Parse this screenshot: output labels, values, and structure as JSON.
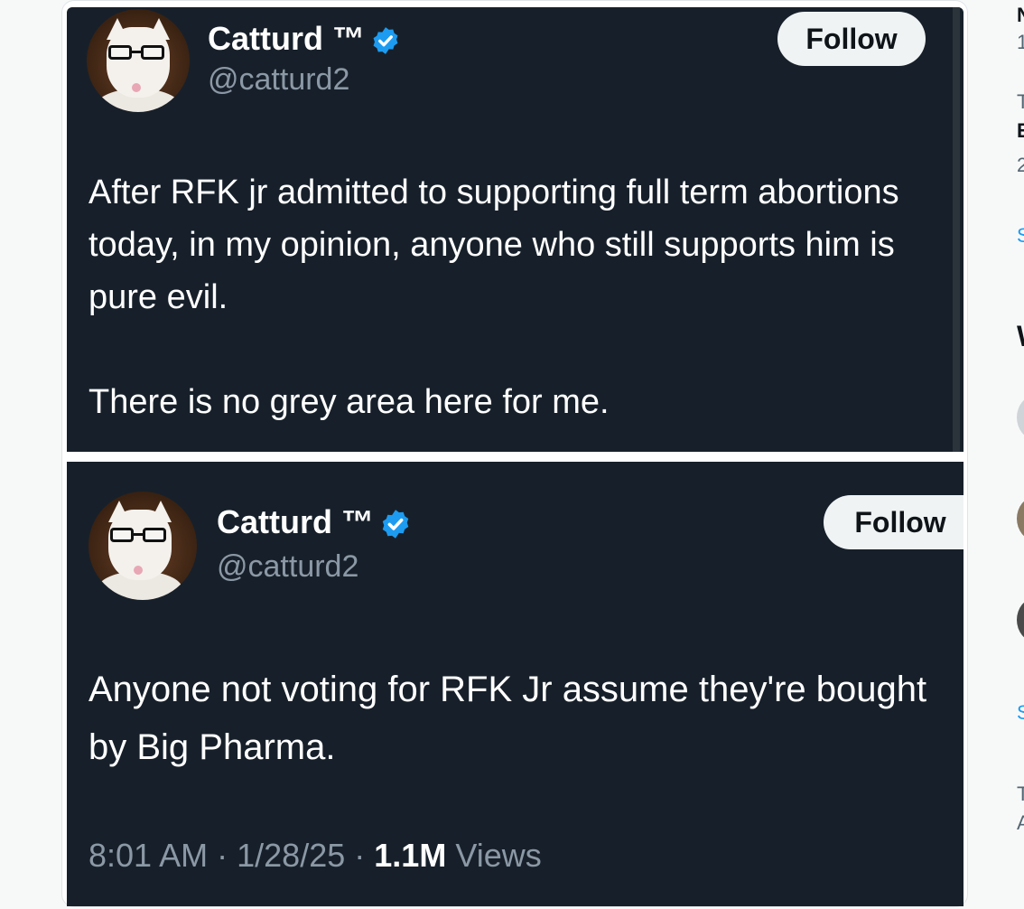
{
  "tweet1": {
    "name": "Catturd ™",
    "handle": "@catturd2",
    "follow_label": "Follow",
    "text": "After RFK jr admitted to supporting full term abortions today, in my opinion, anyone who still supports him is pure evil.\n\nThere is no grey area here for me."
  },
  "tweet2": {
    "name": "Catturd ™",
    "handle": "@catturd2",
    "follow_label": "Follow",
    "text": "Anyone not voting for RFK Jr assume they're bought by Big Pharma.",
    "time": "8:01 AM",
    "date": "1/28/25",
    "views_count": "1.1M",
    "views_label": "Views",
    "separator": "·"
  },
  "sidebar": {
    "frag1": "N",
    "frag2": "1",
    "frag3": "T",
    "frag4": "E",
    "frag5": "2",
    "frag6": "S",
    "frag7": "W",
    "frag8": "S",
    "frag9": "T",
    "frag10": "A"
  },
  "colors": {
    "card_bg": "#17202a",
    "verified": "#1d9bf0",
    "muted": "#8b98a5"
  },
  "icons": [
    "verified-badge-icon",
    "avatar-image"
  ]
}
